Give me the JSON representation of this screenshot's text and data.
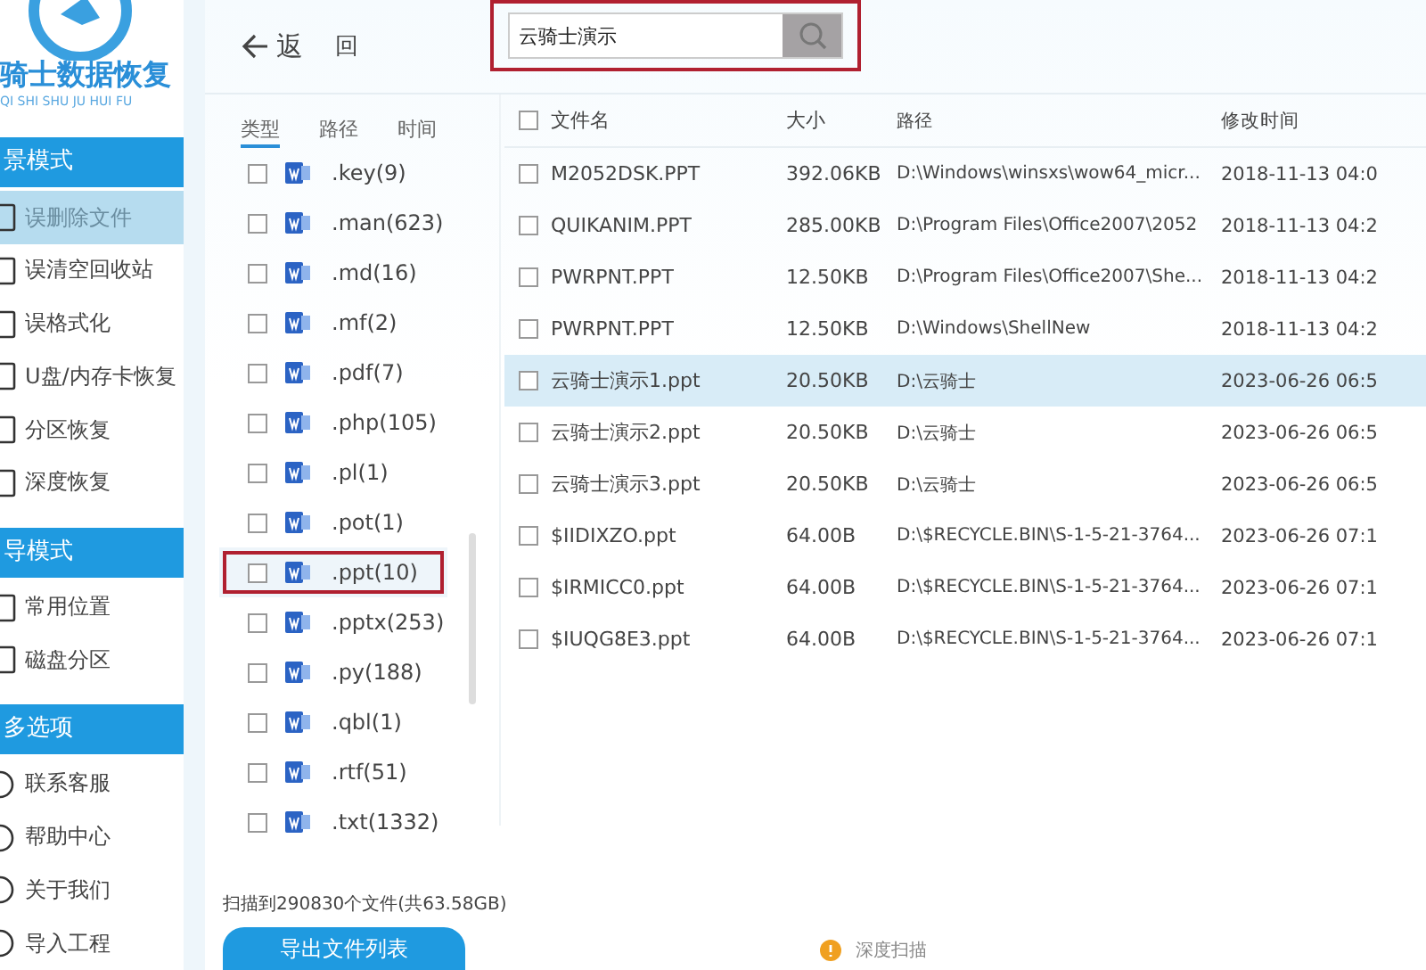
{
  "app": {
    "logo_title": "骑士数据恢复",
    "logo_subtitle": "QI SHI SHU JU HUI FU"
  },
  "sidebar": {
    "sections": [
      {
        "title": "景模式",
        "items": [
          {
            "label": "误删除文件",
            "selected": true
          },
          {
            "label": "误清空回收站",
            "selected": false
          },
          {
            "label": "误格式化",
            "selected": false
          },
          {
            "label": "U盘/内存卡恢复",
            "selected": false
          },
          {
            "label": "分区恢复",
            "selected": false
          },
          {
            "label": "深度恢复",
            "selected": false
          }
        ]
      },
      {
        "title": "导模式",
        "items": [
          {
            "label": "常用位置",
            "selected": false
          },
          {
            "label": "磁盘分区",
            "selected": false
          }
        ]
      },
      {
        "title": "多选项",
        "items": [
          {
            "label": "联系客服",
            "selected": false
          },
          {
            "label": "帮助中心",
            "selected": false
          },
          {
            "label": "关于我们",
            "selected": false
          },
          {
            "label": "导入工程",
            "selected": false
          }
        ]
      }
    ]
  },
  "toolbar": {
    "back": "返",
    "back_2": "回",
    "search": {
      "value": "云骑士演示"
    }
  },
  "filter_tabs": [
    {
      "label": "类型",
      "selected": true
    },
    {
      "label": "路径",
      "selected": false
    },
    {
      "label": "时间",
      "selected": false
    }
  ],
  "types": [
    {
      "label": ".key(9)",
      "checked": false,
      "selected": false
    },
    {
      "label": ".man(623)",
      "checked": false,
      "selected": false
    },
    {
      "label": ".md(16)",
      "checked": false,
      "selected": false
    },
    {
      "label": ".mf(2)",
      "checked": false,
      "selected": false
    },
    {
      "label": ".pdf(7)",
      "checked": false,
      "selected": false
    },
    {
      "label": ".php(105)",
      "checked": false,
      "selected": false
    },
    {
      "label": ".pl(1)",
      "checked": false,
      "selected": false
    },
    {
      "label": ".pot(1)",
      "checked": false,
      "selected": false
    },
    {
      "label": ".ppt(10)",
      "checked": false,
      "selected": true
    },
    {
      "label": ".pptx(253)",
      "checked": false,
      "selected": false
    },
    {
      "label": ".py(188)",
      "checked": false,
      "selected": false
    },
    {
      "label": ".qbl(1)",
      "checked": false,
      "selected": false
    },
    {
      "label": ".rtf(51)",
      "checked": false,
      "selected": false
    },
    {
      "label": ".txt(1332)",
      "checked": false,
      "selected": false
    }
  ],
  "table": {
    "columns": [
      "文件名",
      "大小",
      "路径",
      "修改时间"
    ],
    "header_checked": false,
    "rows": [
      {
        "name": "M2052DSK.PPT",
        "size": "392.06KB",
        "path": "D:\\Windows\\winsxs\\wow64_micr...",
        "time": "2018-11-13 04:0",
        "checked": false,
        "selected": false
      },
      {
        "name": "QUIKANIM.PPT",
        "size": "285.00KB",
        "path": "D:\\Program Files\\Office2007\\2052",
        "time": "2018-11-13 04:2",
        "checked": false,
        "selected": false
      },
      {
        "name": "PWRPNT.PPT",
        "size": "12.50KB",
        "path": "D:\\Program Files\\Office2007\\She...",
        "time": "2018-11-13 04:2",
        "checked": false,
        "selected": false
      },
      {
        "name": "PWRPNT.PPT",
        "size": "12.50KB",
        "path": "D:\\Windows\\ShellNew",
        "time": "2018-11-13 04:2",
        "checked": false,
        "selected": false
      },
      {
        "name": "云骑士演示1.ppt",
        "size": "20.50KB",
        "path": "D:\\云骑士",
        "time": "2023-06-26 06:5",
        "checked": false,
        "selected": true
      },
      {
        "name": "云骑士演示2.ppt",
        "size": "20.50KB",
        "path": "D:\\云骑士",
        "time": "2023-06-26 06:5",
        "checked": false,
        "selected": false
      },
      {
        "name": "云骑士演示3.ppt",
        "size": "20.50KB",
        "path": "D:\\云骑士",
        "time": "2023-06-26 06:5",
        "checked": false,
        "selected": false
      },
      {
        "name": "$IIDIXZO.ppt",
        "size": "64.00B",
        "path": "D:\\$RECYCLE.BIN\\S-1-5-21-3764...",
        "time": "2023-06-26 07:1",
        "checked": false,
        "selected": false
      },
      {
        "name": "$IRMICC0.ppt",
        "size": "64.00B",
        "path": "D:\\$RECYCLE.BIN\\S-1-5-21-3764...",
        "time": "2023-06-26 07:1",
        "checked": false,
        "selected": false
      },
      {
        "name": "$IUQG8E3.ppt",
        "size": "64.00B",
        "path": "D:\\$RECYCLE.BIN\\S-1-5-21-3764...",
        "time": "2023-06-26 07:1",
        "checked": false,
        "selected": false
      }
    ]
  },
  "footer": {
    "scan_summary": "扫描到290830个文件(共63.58GB)",
    "export_button": "导出文件列表",
    "notice": "深度扫描"
  }
}
